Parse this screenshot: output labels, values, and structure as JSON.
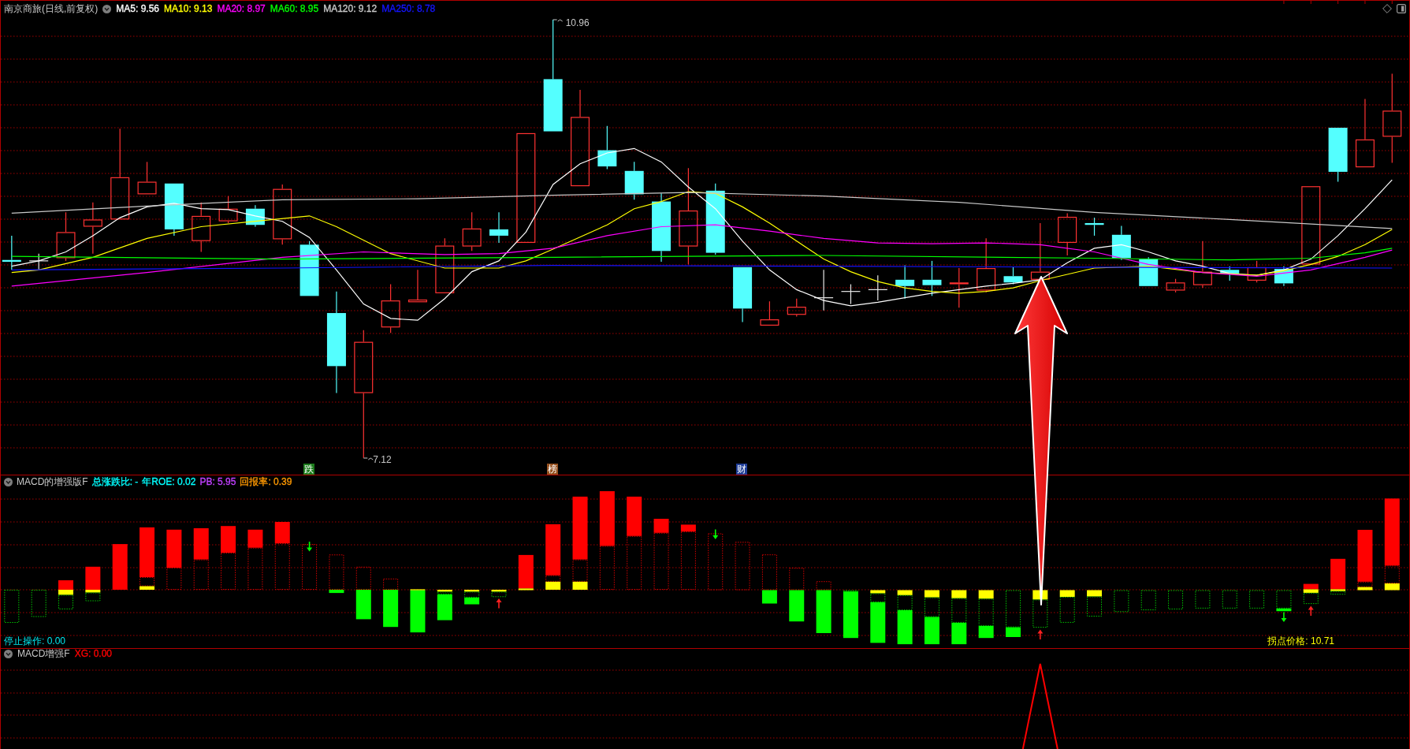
{
  "main_chart": {
    "title": "南京商旅(日线,前复权)",
    "indicators": [
      {
        "label": "MA5: 9.56",
        "color": "#ffffff"
      },
      {
        "label": "MA10: 9.13",
        "color": "#ffff00"
      },
      {
        "label": "MA20: 8.97",
        "color": "#ff00ff"
      },
      {
        "label": "MA60: 8.95",
        "color": "#00ff00"
      },
      {
        "label": "MA120: 9.12",
        "color": "#c8c8c8"
      },
      {
        "label": "MA250: 8.78",
        "color": "#1414ff"
      }
    ],
    "high_label": "10.96",
    "low_label": "7.12",
    "event_tags": [
      {
        "text": "跌",
        "color": "#1c7c1c"
      },
      {
        "text": "榜",
        "color": "#96501e"
      },
      {
        "text": "财",
        "color": "#1e3c96"
      }
    ]
  },
  "macd_panel": {
    "title": "MACD的增强版F",
    "readouts": [
      {
        "label": "总涨跌比: -",
        "color": "#00ffff"
      },
      {
        "label": "年ROE: 0.02",
        "color": "#00ffff"
      },
      {
        "label": "PB: 5.95",
        "color": "#c040ff"
      },
      {
        "label": "回报率: 0.39",
        "color": "#ff9900"
      }
    ],
    "stop_label": "停止操作: 0.00",
    "turn_price_label": "拐点价格: 10.71"
  },
  "signal_panel": {
    "title": "MACD增强F",
    "readouts": [
      {
        "label": "XG: 0.00",
        "color": "#ff0000"
      }
    ]
  }
}
